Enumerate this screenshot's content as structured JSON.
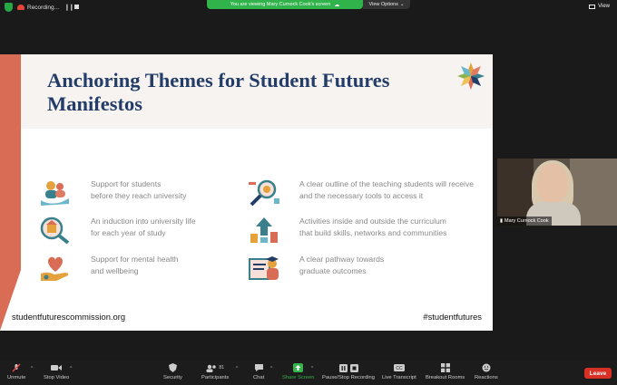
{
  "top_bar": {
    "recording_label": "Recording...",
    "banner_text": "You are viewing Mary Curnock Cook's screen",
    "view_options_label": "View Options",
    "view_label": "View"
  },
  "slide": {
    "title": "Anchoring Themes for Student Futures Manifestos",
    "left_items": [
      {
        "text": "Support for students\nbefore they reach university"
      },
      {
        "text": "An induction into university life\nfor each year of study"
      },
      {
        "text": "Support for mental health\nand wellbeing"
      }
    ],
    "right_items": [
      {
        "text": "A clear outline of the teaching students will receive\nand the necessary tools to access it"
      },
      {
        "text": "Activities inside and outside the curriculum\nthat build skills, networks and communities"
      },
      {
        "text": "A clear pathway towards\ngraduate outcomes"
      }
    ],
    "footer_url": "studentfuturescommission.org",
    "footer_hashtag": "#studentfutures",
    "colors": {
      "title": "#233c68",
      "accent": "#d86c55",
      "teal": "#3a7f8c"
    }
  },
  "participant_video": {
    "name": "Mary Curnock Cook"
  },
  "toolbar": {
    "unmute": "Unmute",
    "stop_video": "Stop Video",
    "security": "Security",
    "participants": "Participants",
    "participants_count": "81",
    "chat": "Chat",
    "share_screen": "Share Screen",
    "pause_stop_recording": "Pause/Stop Recording",
    "live_transcript": "Live Transcript",
    "breakout_rooms": "Breakout Rooms",
    "reactions": "Reactions",
    "leave": "Leave",
    "colors": {
      "share_green": "#36b34a",
      "leave_red": "#d93025"
    }
  }
}
